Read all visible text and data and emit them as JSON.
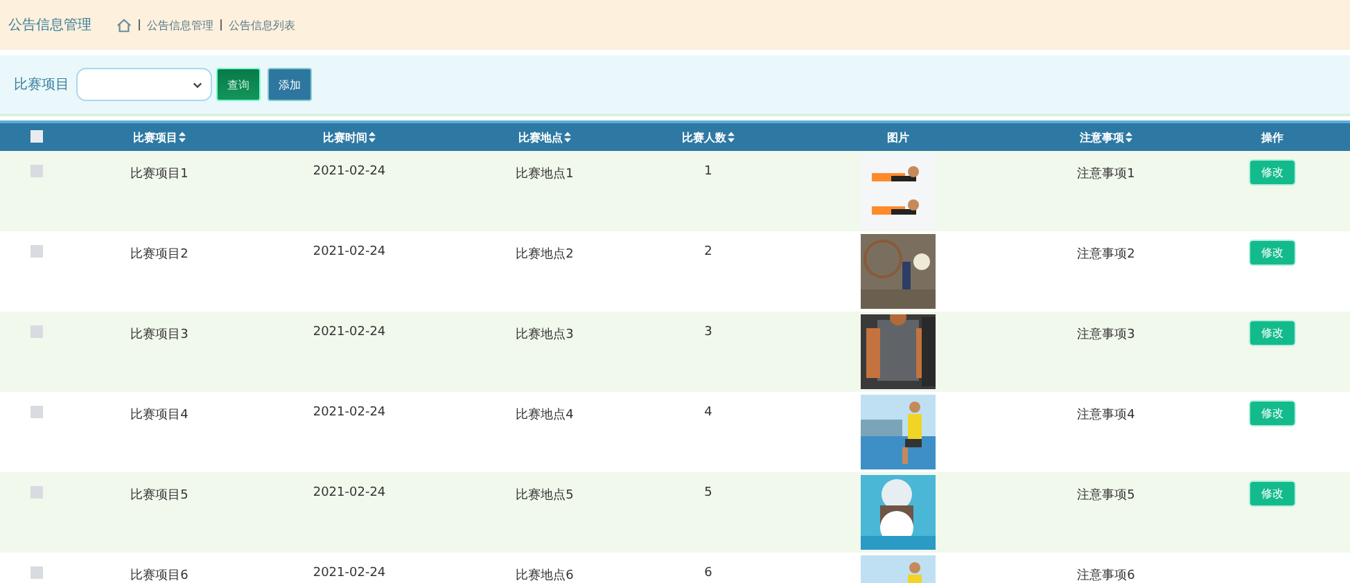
{
  "header": {
    "title": "公告信息管理",
    "breadcrumb": [
      "公告信息管理",
      "公告信息列表"
    ]
  },
  "toolbar": {
    "filter_label": "比赛项目",
    "search_button": "查询",
    "add_button": "添加"
  },
  "table": {
    "select_all": {
      "checked": false
    },
    "columns": [
      {
        "label": "比赛项目",
        "sortable": true
      },
      {
        "label": "比赛时间",
        "sortable": true
      },
      {
        "label": "比赛地点",
        "sortable": true
      },
      {
        "label": "比赛人数",
        "sortable": true
      },
      {
        "label": "图片",
        "sortable": false
      },
      {
        "label": "注意事项",
        "sortable": true
      },
      {
        "label": "操作",
        "sortable": false
      }
    ],
    "rows": [
      {
        "checked": false,
        "cells": [
          "比赛项目1",
          "2021-02-24",
          "比赛地点1",
          "1"
        ],
        "note": "注意事项1",
        "action": "修改"
      },
      {
        "checked": false,
        "cells": [
          "比赛项目2",
          "2021-02-24",
          "比赛地点2",
          "2"
        ],
        "note": "注意事项2",
        "action": "修改"
      },
      {
        "checked": false,
        "cells": [
          "比赛项目3",
          "2021-02-24",
          "比赛地点3",
          "3"
        ],
        "note": "注意事项3",
        "action": "修改"
      },
      {
        "checked": false,
        "cells": [
          "比赛项目4",
          "2021-02-24",
          "比赛地点4",
          "4"
        ],
        "note": "注意事项4",
        "action": "修改"
      },
      {
        "checked": false,
        "cells": [
          "比赛项目5",
          "2021-02-24",
          "比赛地点5",
          "5"
        ],
        "note": "注意事项5",
        "action": "修改"
      },
      {
        "checked": false,
        "cells": [
          "比赛项目6",
          "2021-02-24",
          "比赛地点6",
          "6"
        ],
        "note": "注意事项6"
      }
    ]
  }
}
